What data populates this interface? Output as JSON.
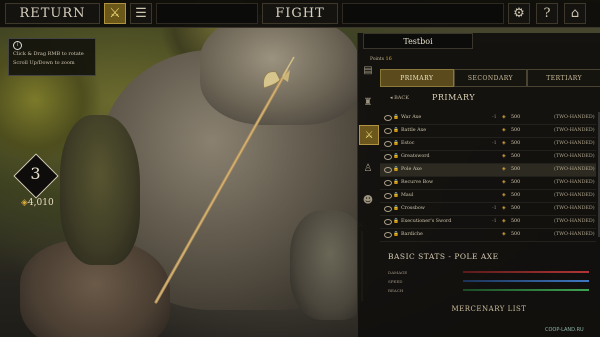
{
  "topbar": {
    "return_label": "RETURN",
    "fight_label": "FIGHT",
    "help_label": "?"
  },
  "info_box": {
    "line1": "Click & Drag RMB to rotate",
    "line2": "Scroll Up/Down to zoom"
  },
  "player": {
    "level": "3",
    "gold": "4,010"
  },
  "panel": {
    "title": "Testboi",
    "points_label": "Points",
    "points_value": "16",
    "tabs": [
      "PRIMARY",
      "SECONDARY",
      "TERTIARY"
    ],
    "back_label": "BACK",
    "breadcrumb": "PRIMARY",
    "weapons": [
      {
        "name": "War Axe",
        "neg": "-1",
        "cost": "500",
        "type": "(TWO-HANDED)"
      },
      {
        "name": "Battle Axe",
        "neg": "",
        "cost": "500",
        "type": "(TWO-HANDED)"
      },
      {
        "name": "Estoc",
        "neg": "-1",
        "cost": "500",
        "type": "(TWO-HANDED)"
      },
      {
        "name": "Greatsword",
        "neg": "",
        "cost": "500",
        "type": "(TWO-HANDED)"
      },
      {
        "name": "Pole Axe",
        "neg": "",
        "cost": "500",
        "type": "(TWO-HANDED)"
      },
      {
        "name": "Recurve Bow",
        "neg": "",
        "cost": "500",
        "type": "(TWO-HANDED)"
      },
      {
        "name": "Maul",
        "neg": "",
        "cost": "500",
        "type": "(TWO-HANDED)"
      },
      {
        "name": "Crossbow",
        "neg": "-1",
        "cost": "500",
        "type": "(TWO-HANDED)"
      },
      {
        "name": "Executioner's Sword",
        "neg": "-1",
        "cost": "500",
        "type": "(TWO-HANDED)"
      },
      {
        "name": "Bardiche",
        "neg": "",
        "cost": "500",
        "type": "(TWO-HANDED)"
      }
    ],
    "selected_index": 4,
    "stats_title": "BASIC STATS - POLE AXE",
    "stats": [
      {
        "label": "DAMAGE",
        "color": "#a33232"
      },
      {
        "label": "SPEED",
        "color": "#3a6fb0"
      },
      {
        "label": "REACH",
        "color": "#3a9a4a"
      }
    ],
    "mercenary_label": "MERCENARY LIST"
  },
  "watermark": "COOP-LAND.RU",
  "colors": {
    "gold": "#d9a93b",
    "accent_tab": "#5a4a1c"
  },
  "icons": {
    "weapon_icon": "crossed-axes-icon",
    "scroll_icon": "scroll-icon",
    "settings_icon": "gear-icon",
    "exit_icon": "door-icon"
  }
}
